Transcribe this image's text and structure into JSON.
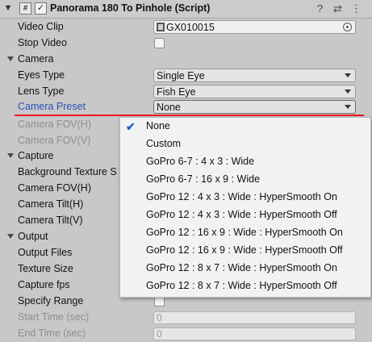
{
  "component": {
    "title": "Panorama 180 To Pinhole (Script)",
    "script_icon": "#",
    "enabled_check": "✓",
    "help_icon": "?",
    "settings_icon": "⇄",
    "menu_icon": "⋮"
  },
  "fields": {
    "video_clip": {
      "label": "Video Clip",
      "value": "GX010015"
    },
    "stop_video": {
      "label": "Stop Video"
    },
    "camera_section": "Camera",
    "eyes_type": {
      "label": "Eyes Type",
      "value": "Single Eye"
    },
    "lens_type": {
      "label": "Lens Type",
      "value": "Fish Eye"
    },
    "camera_preset": {
      "label": "Camera Preset",
      "value": "None"
    },
    "camera_fov_h": {
      "label": "Camera FOV(H)"
    },
    "camera_fov_v": {
      "label": "Camera FOV(V)"
    },
    "capture_section": "Capture",
    "background_texture": {
      "label": "Background Texture S"
    },
    "capture_fov_h": {
      "label": "Camera FOV(H)"
    },
    "capture_tilt_h": {
      "label": "Camera Tilt(H)"
    },
    "capture_tilt_v": {
      "label": "Camera Tilt(V)"
    },
    "output_section": "Output",
    "output_files": {
      "label": "Output Files"
    },
    "texture_size": {
      "label": "Texture Size"
    },
    "capture_fps": {
      "label": "Capture fps"
    },
    "specify_range": {
      "label": "Specify Range"
    },
    "start_time": {
      "label": "Start Time (sec)",
      "value": "0"
    },
    "end_time": {
      "label": "End Time (sec)",
      "value": "0"
    }
  },
  "preset_menu": {
    "selected_index": 0,
    "check_mark": "✔",
    "items": [
      "None",
      "Custom",
      "GoPro 6-7 : 4 x 3 : Wide",
      "GoPro 6-7 : 16 x 9 : Wide",
      "GoPro 12 : 4 x 3 : Wide : HyperSmooth On",
      "GoPro 12 : 4 x 3 : Wide : HyperSmooth Off",
      "GoPro 12 : 16 x 9 : Wide : HyperSmooth On",
      "GoPro 12 : 16 x 9 : Wide : HyperSmooth Off",
      "GoPro 12 : 8 x 7 : Wide : HyperSmooth On",
      "GoPro 12 : 8 x 7 : Wide : HyperSmooth Off"
    ]
  },
  "colors": {
    "panel_bg": "#c8c8c8",
    "label_highlight": "#2a4fbc",
    "annotation_line": "#e8141c",
    "check_accent": "#1d5fd8"
  }
}
